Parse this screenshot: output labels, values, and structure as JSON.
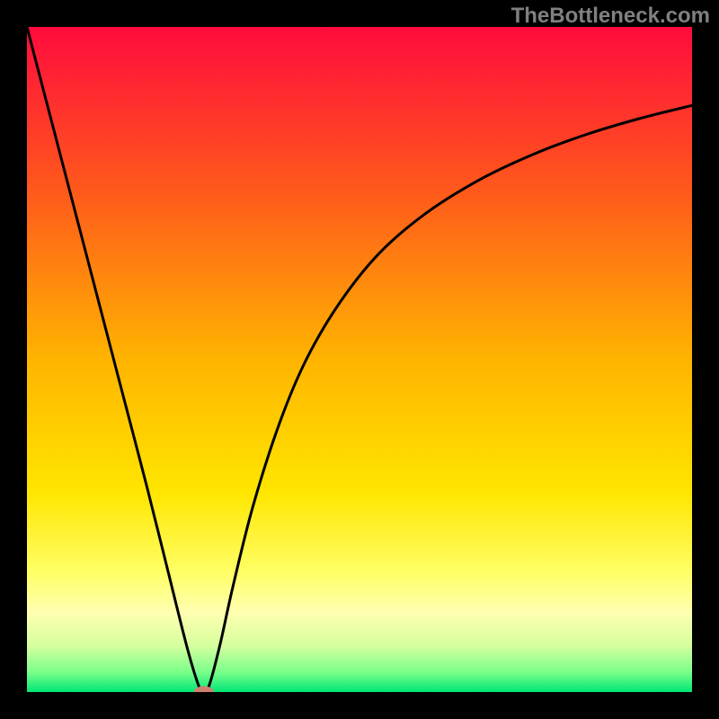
{
  "watermark": "TheBottleneck.com",
  "chart_data": {
    "type": "line",
    "title": "",
    "xlabel": "",
    "ylabel": "",
    "xlim": [
      0,
      1
    ],
    "ylim": [
      0,
      1
    ],
    "background_gradient": {
      "type": "vertical",
      "stops": [
        {
          "offset": 0.0,
          "color": "#ff0b3d"
        },
        {
          "offset": 0.25,
          "color": "#ff5a1b"
        },
        {
          "offset": 0.5,
          "color": "#ffb400"
        },
        {
          "offset": 0.7,
          "color": "#ffe600"
        },
        {
          "offset": 0.82,
          "color": "#ffff66"
        },
        {
          "offset": 0.88,
          "color": "#ffffb0"
        },
        {
          "offset": 0.93,
          "color": "#d6ff9e"
        },
        {
          "offset": 0.97,
          "color": "#7aff8a"
        },
        {
          "offset": 1.0,
          "color": "#00e676"
        }
      ]
    },
    "series": [
      {
        "name": "bottleneck-curve",
        "color": "#000000",
        "x": [
          0.0,
          0.03,
          0.06,
          0.09,
          0.12,
          0.15,
          0.18,
          0.21,
          0.24,
          0.258,
          0.266,
          0.274,
          0.29,
          0.31,
          0.34,
          0.38,
          0.42,
          0.47,
          0.53,
          0.6,
          0.68,
          0.76,
          0.84,
          0.92,
          1.0
        ],
        "y": [
          1.0,
          0.885,
          0.77,
          0.655,
          0.54,
          0.425,
          0.31,
          0.19,
          0.07,
          0.01,
          0.0,
          0.01,
          0.07,
          0.16,
          0.28,
          0.405,
          0.5,
          0.585,
          0.66,
          0.72,
          0.77,
          0.808,
          0.838,
          0.862,
          0.882
        ]
      }
    ],
    "marker": {
      "x": 0.266,
      "y": 0.0,
      "color": "#d08070",
      "rx": 0.015,
      "ry": 0.009
    }
  }
}
